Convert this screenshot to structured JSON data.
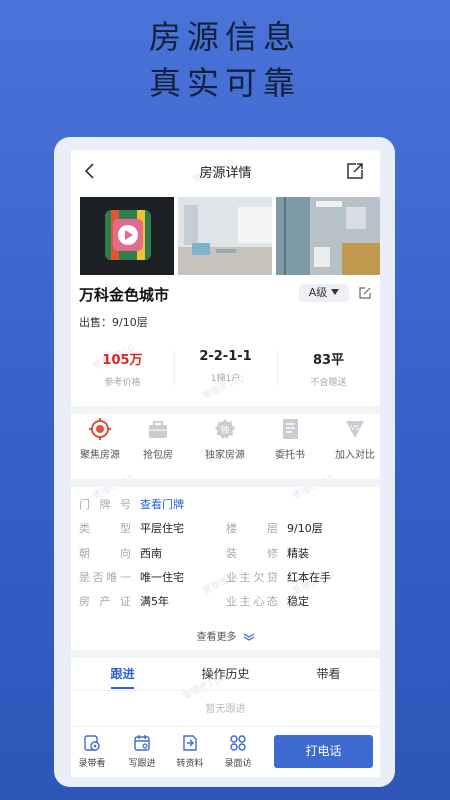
{
  "banner": {
    "line1": "房源信息",
    "line2": "真实可靠"
  },
  "header": {
    "title": "房源详情",
    "back_icon": "chevron-left-icon",
    "share_icon": "share-icon"
  },
  "property": {
    "name": "万科金色城市",
    "grade": "A级",
    "sale_info": "出售：9/10层",
    "stats": [
      {
        "value": "105万",
        "label": "参考价格",
        "color": "#d9271f"
      },
      {
        "value": "2-2-1-1",
        "label": "1梯1户"
      },
      {
        "value": "83平",
        "label": "不含赠送"
      }
    ]
  },
  "actions": [
    {
      "label": "聚焦房源",
      "icon": "target-icon",
      "color": "#e0503a"
    },
    {
      "label": "抢包房",
      "icon": "bag-icon"
    },
    {
      "label": "独家房源",
      "icon": "exclusive-badge-icon"
    },
    {
      "label": "委托书",
      "icon": "document-icon"
    },
    {
      "label": "加入对比",
      "icon": "vs-icon"
    }
  ],
  "details": {
    "doorplate_label": "门牌号",
    "doorplate_link": "查看门牌",
    "rows": [
      {
        "label1": "类型",
        "value1": "平层住宅",
        "label2": "楼层",
        "value2": "9/10层"
      },
      {
        "label1": "朝向",
        "value1": "西南",
        "label2": "装修",
        "value2": "精装"
      },
      {
        "label1": "是否唯一",
        "value1": "唯一住宅",
        "label2": "业主欠贷",
        "value2": "红本在手"
      },
      {
        "label1": "房产证",
        "value1": "满5年",
        "label2": "业主心态",
        "value2": "稳定"
      }
    ],
    "more": "查看更多"
  },
  "tabs": [
    {
      "label": "跟进",
      "active": true
    },
    {
      "label": "操作历史"
    },
    {
      "label": "带看"
    }
  ],
  "empty_text": "暂无跟进",
  "toolbar": {
    "items": [
      {
        "label": "录带看",
        "icon": "record-visit-icon"
      },
      {
        "label": "写跟进",
        "icon": "calendar-icon"
      },
      {
        "label": "转资料",
        "icon": "transfer-doc-icon"
      },
      {
        "label": "录面访",
        "icon": "people-icon"
      }
    ],
    "call": "打电话"
  },
  "watermark": "管理员110",
  "colors": {
    "accent": "#2b62d6",
    "price": "#d9271f",
    "button": "#3e6bd1"
  }
}
